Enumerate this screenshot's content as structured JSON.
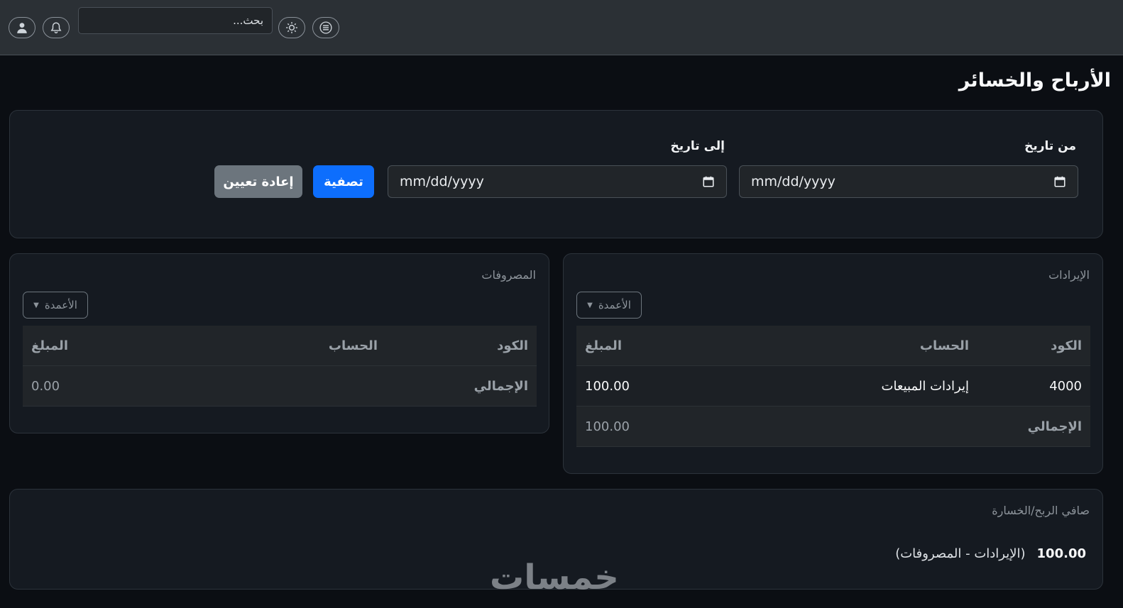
{
  "header": {
    "search_placeholder": "بحث...",
    "icons": [
      "user-icon",
      "bell-icon",
      "sun-icon",
      "menu-icon"
    ]
  },
  "page": {
    "title": "الأرباح والخسائر"
  },
  "filter": {
    "from_label": "من تاريخ",
    "to_label": "إلى تاريخ",
    "from_value": "mm/dd/yyyy",
    "to_value": "mm/dd/yyyy",
    "filter_button": "تصفية",
    "reset_button": "إعادة تعيين"
  },
  "revenue": {
    "title": "الإيرادات",
    "columns_button": "الأعمدة",
    "headers": {
      "code": "الكود",
      "account": "الحساب",
      "amount": "المبلغ"
    },
    "rows": [
      {
        "code": "4000",
        "account": "إيرادات المبيعات",
        "amount": "100.00"
      }
    ],
    "total_label": "الإجمالي",
    "total_amount": "100.00"
  },
  "expenses": {
    "title": "المصروفات",
    "columns_button": "الأعمدة",
    "headers": {
      "code": "الكود",
      "account": "الحساب",
      "amount": "المبلغ"
    },
    "total_label": "الإجمالي",
    "total_amount": "0.00"
  },
  "net": {
    "title": "صافي الربح/الخسارة",
    "value": "100.00",
    "note": "(الإيرادات - المصروفات)"
  },
  "watermark": "خمسات",
  "colors": {
    "accent": "#0d6efd",
    "secondary": "#6c757d",
    "background": "#0b0e13",
    "card": "#151a21"
  }
}
